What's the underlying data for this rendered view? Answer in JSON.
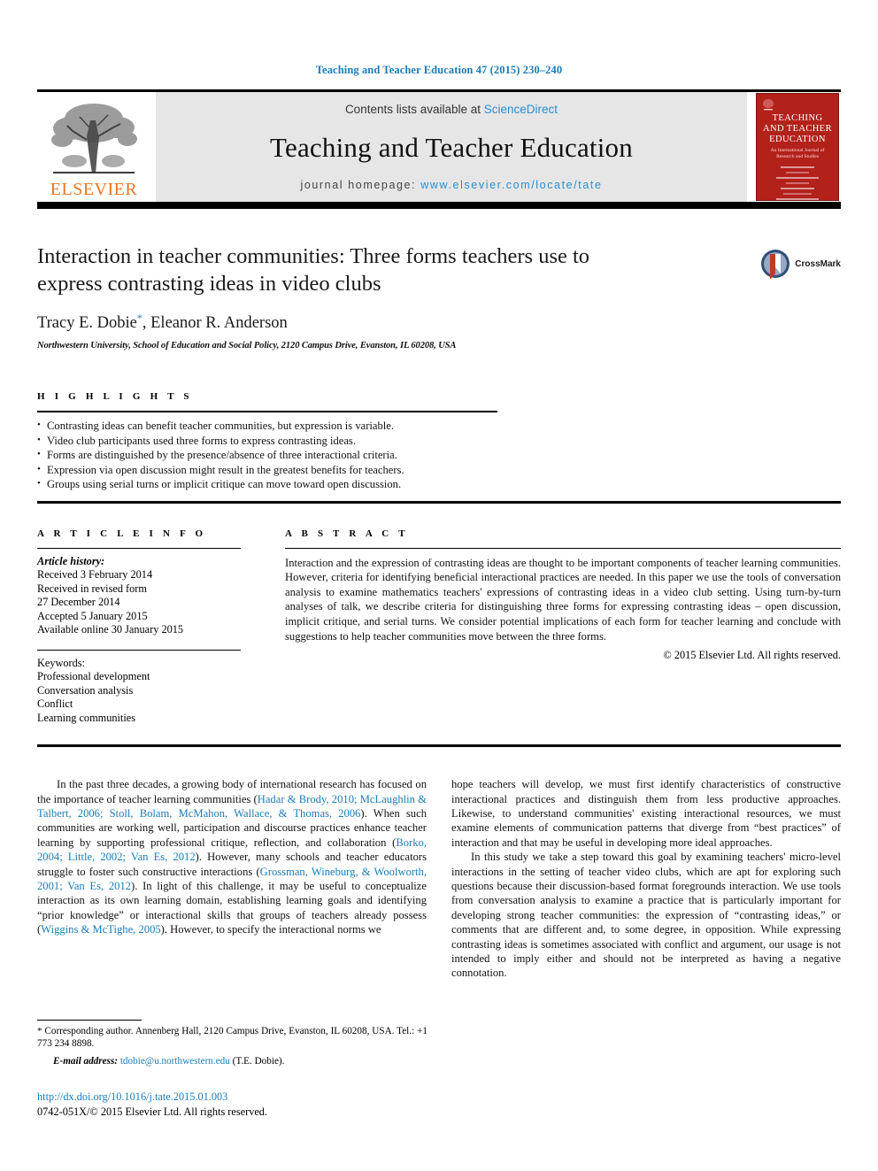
{
  "running_head": "Teaching and Teacher Education 47 (2015) 230–240",
  "masthead": {
    "contents_prefix": "Contents lists available at ",
    "sciencedirect": "ScienceDirect",
    "journal_name": "Teaching and Teacher Education",
    "homepage_prefix": "journal homepage: ",
    "homepage_url": "www.elsevier.com/locate/tate",
    "publisher_wordmark": "ELSEVIER",
    "publisher_color": "#e87722",
    "link_color": "#2a8fd0"
  },
  "cover": {
    "title_line1": "TEACHING",
    "title_line2": "AND TEACHER",
    "title_line3": "EDUCATION",
    "subtitle": "An International Journal of Research and Studies",
    "background_color": "#b3211b"
  },
  "article": {
    "title": "Interaction in teacher communities: Three forms teachers use to express contrasting ideas in video clubs",
    "authors": "Tracy E. Dobie",
    "author_marker": "*",
    "authors_rest": ", Eleanor R. Anderson",
    "affiliation": "Northwestern University, School of Education and Social Policy, 2120 Campus Drive, Evanston, IL 60208, USA",
    "crossmark_label": "CrossMark"
  },
  "highlights": {
    "heading": "H I G H L I G H T S",
    "items": [
      "Contrasting ideas can benefit teacher communities, but expression is variable.",
      "Video club participants used three forms to express contrasting ideas.",
      "Forms are distinguished by the presence/absence of three interactional criteria.",
      "Expression via open discussion might result in the greatest benefits for teachers.",
      "Groups using serial turns or implicit critique can move toward open discussion."
    ]
  },
  "article_info": {
    "heading": "A R T I C L E   I N F O",
    "history_label": "Article history:",
    "history": [
      "Received 3 February 2014",
      "Received in revised form",
      "27 December 2014",
      "Accepted 5 January 2015",
      "Available online 30 January 2015"
    ],
    "keywords_label": "Keywords:",
    "keywords": [
      "Professional development",
      "Conversation analysis",
      "Conflict",
      "Learning communities"
    ]
  },
  "abstract": {
    "heading": "A B S T R A C T",
    "text": "Interaction and the expression of contrasting ideas are thought to be important components of teacher learning communities. However, criteria for identifying beneficial interactional practices are needed. In this paper we use the tools of conversation analysis to examine mathematics teachers' expressions of contrasting ideas in a video club setting. Using turn-by-turn analyses of talk, we describe criteria for distinguishing three forms for expressing contrasting ideas – open discussion, implicit critique, and serial turns. We consider potential implications of each form for teacher learning and conclude with suggestions to help teacher communities move between the three forms.",
    "copyright": "© 2015 Elsevier Ltd. All rights reserved."
  },
  "body": {
    "left_para1_a": "In the past three decades, a growing body of international research has focused on the importance of teacher learning communities (",
    "left_para1_ref1": "Hadar & Brody, 2010; McLaughlin & Talbert, 2006; Stoll, Bolam, McMahon, Wallace, & Thomas, 2006",
    "left_para1_b": "). When such communities are working well, participation and discourse practices enhance teacher learning by supporting professional critique, reflection, and collaboration (",
    "left_para1_ref2": "Borko, 2004; Little, 2002; Van Es, 2012",
    "left_para1_c": "). However, many schools and teacher educators struggle to foster such constructive interactions (",
    "left_para1_ref3": "Grossman, Wineburg, & Woolworth, 2001; Van Es, 2012",
    "left_para1_d": "). In light of this challenge, it may be useful to conceptualize interaction as its own learning domain, establishing learning goals and identifying “prior knowledge” or interactional skills that groups of teachers already possess (",
    "left_para1_ref4": "Wiggins & McTighe, 2005",
    "left_para1_e": "). However, to specify the interactional norms we",
    "right_para1": "hope teachers will develop, we must first identify characteristics of constructive interactional practices and distinguish them from less productive approaches. Likewise, to understand communities' existing interactional resources, we must examine elements of communication patterns that diverge from “best practices” of interaction and that may be useful in developing more ideal approaches.",
    "right_para2": "In this study we take a step toward this goal by examining teachers' micro-level interactions in the setting of teacher video clubs, which are apt for exploring such questions because their discussion-based format foregrounds interaction. We use tools from conversation analysis to examine a practice that is particularly important for developing strong teacher communities: the expression of “contrasting ideas,” or comments that are different and, to some degree, in opposition. While expressing contrasting ideas is sometimes associated with conflict and argument, our usage is not intended to imply either and should not be interpreted as having a negative connotation."
  },
  "footnote": {
    "star": "*",
    "text": " Corresponding author. Annenberg Hall, 2120 Campus Drive, Evanston, IL 60208, USA. Tel.: +1 773 234 8898.",
    "email_label": "E-mail address:",
    "email": "tdobie@u.northwestern.edu",
    "email_suffix": " (T.E. Dobie)."
  },
  "footer": {
    "doi": "http://dx.doi.org/10.1016/j.tate.2015.01.003",
    "issn": "0742-051X/© 2015 Elsevier Ltd. All rights reserved."
  }
}
